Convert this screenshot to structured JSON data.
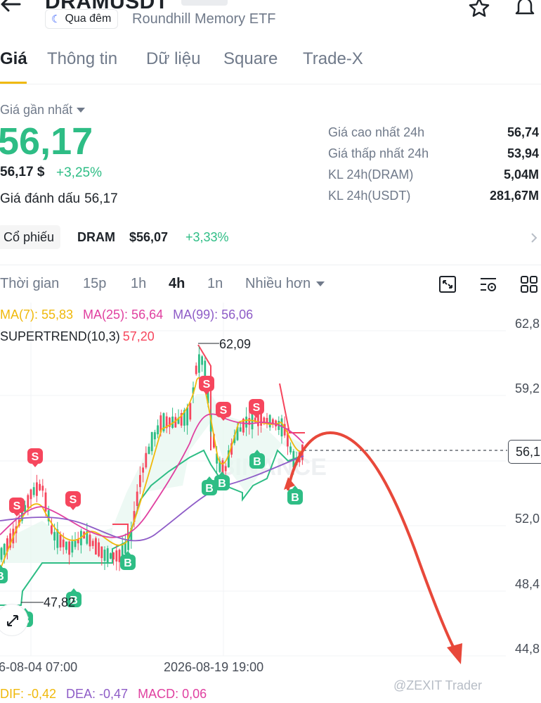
{
  "header": {
    "symbol": "DRAMUSDT",
    "session_label": "Qua đêm",
    "asset_name": "Roundhill Memory ETF",
    "icons": [
      "back-arrow-icon",
      "star-icon",
      "bell-icon",
      "moon-icon"
    ]
  },
  "tabs": [
    "Giá",
    "Thông tin",
    "Dữ liệu",
    "Square",
    "Trade-X"
  ],
  "price": {
    "last_price_label": "Giá gần nhất",
    "last_price": "56,17",
    "usd_price": "56,17 $",
    "change_pct": "+3,25%",
    "mark_label": "Giá đánh dấu",
    "mark_price": "56,17"
  },
  "stats": [
    {
      "label": "Giá cao nhất 24h",
      "value": "56,74"
    },
    {
      "label": "Giá thấp nhất 24h",
      "value": "53,94"
    },
    {
      "label": "KL 24h(DRAM)",
      "value": "5,04M"
    },
    {
      "label": "KL 24h(USDT)",
      "value": "281,67M"
    }
  ],
  "stock": {
    "chip": "Cổ phiếu",
    "ticker": "DRAM",
    "price": "$56,07",
    "change": "+3,33%"
  },
  "intervals": {
    "time_label": "Thời gian",
    "items": [
      "15p",
      "1h",
      "4h",
      "1n"
    ],
    "active": "4h",
    "more": "Nhiều hơn"
  },
  "chart": {
    "ma7": "MA(7): 55,83",
    "ma25": "MA(25): 56,64",
    "ma99": "MA(99): 56,06",
    "supertrend_label": "SUPERTREND(10,3)",
    "supertrend_value": "57,20",
    "high_marker": "62,09",
    "low_marker": "47,82",
    "current_price_tag": "56,1",
    "y_ticks": [
      "62,8",
      "59,2",
      "52,0",
      "48,4",
      "44,8"
    ],
    "x_ticks": [
      "6-08-04 07:00",
      "2026-08-19 19:00"
    ],
    "watermark": "@ZEXIT Trader",
    "colors": {
      "up": "#2ebd85",
      "down": "#f6465d",
      "ma7": "#f0b90b",
      "ma25": "#e040a0",
      "ma99": "#8e5cc7",
      "arrow": "#e8483a"
    }
  },
  "macd": {
    "dif": "DIF: -0,42",
    "dea": "DEA: -0,47",
    "macd": "MACD: 0,06"
  }
}
